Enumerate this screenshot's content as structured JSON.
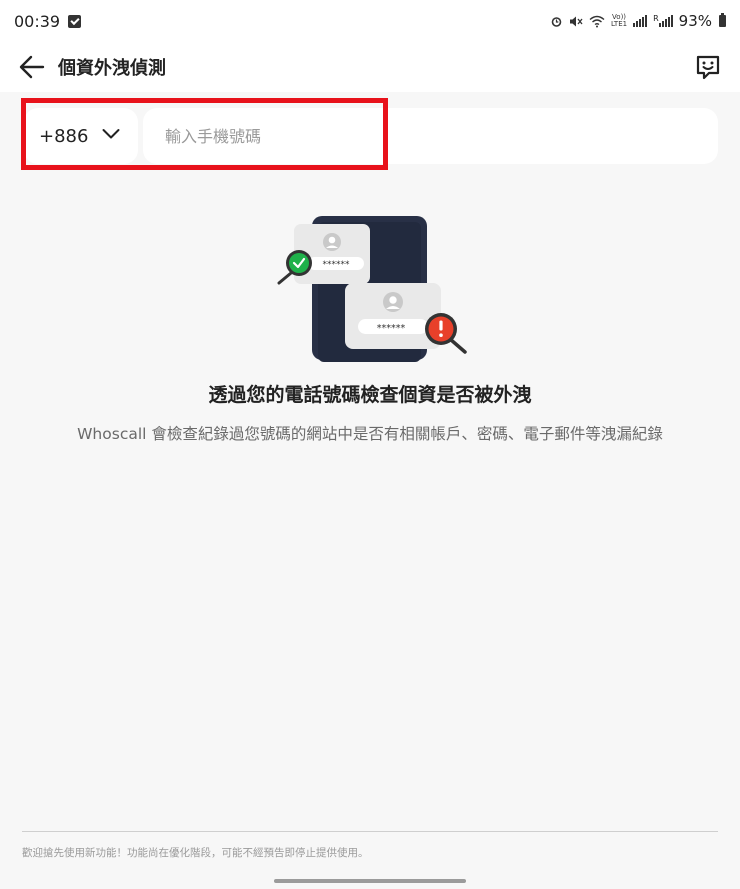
{
  "status_bar": {
    "time": "00:39",
    "battery_percent": "93%",
    "icons": [
      "alarm-icon",
      "mute-icon",
      "wifi-icon",
      "volte-icon",
      "signal-icon",
      "signal-r-icon",
      "battery-icon"
    ],
    "volte_label": "Vo))\nLTE1",
    "signal_label": "R"
  },
  "app_bar": {
    "title": "個資外洩偵測"
  },
  "search": {
    "country_code": "+886",
    "phone_placeholder": "輸入手機號碼",
    "phone_value": ""
  },
  "illustration": {
    "masked_password": "******"
  },
  "content": {
    "headline": "透過您的電話號碼檢查個資是否被外洩",
    "description": "Whoscall 會檢查紀錄過您號碼的網站中是否有相關帳戶、密碼、電子郵件等洩漏紀錄"
  },
  "footer": {
    "note": "歡迎搶先使用新功能！功能尚在優化階段，可能不經預告即停止提供使用。"
  },
  "colors": {
    "highlight": "#e8121b",
    "background": "#f7f7f7",
    "phone_dark": "#283046",
    "check_green": "#1fb14a",
    "alert_red": "#e8402a"
  }
}
